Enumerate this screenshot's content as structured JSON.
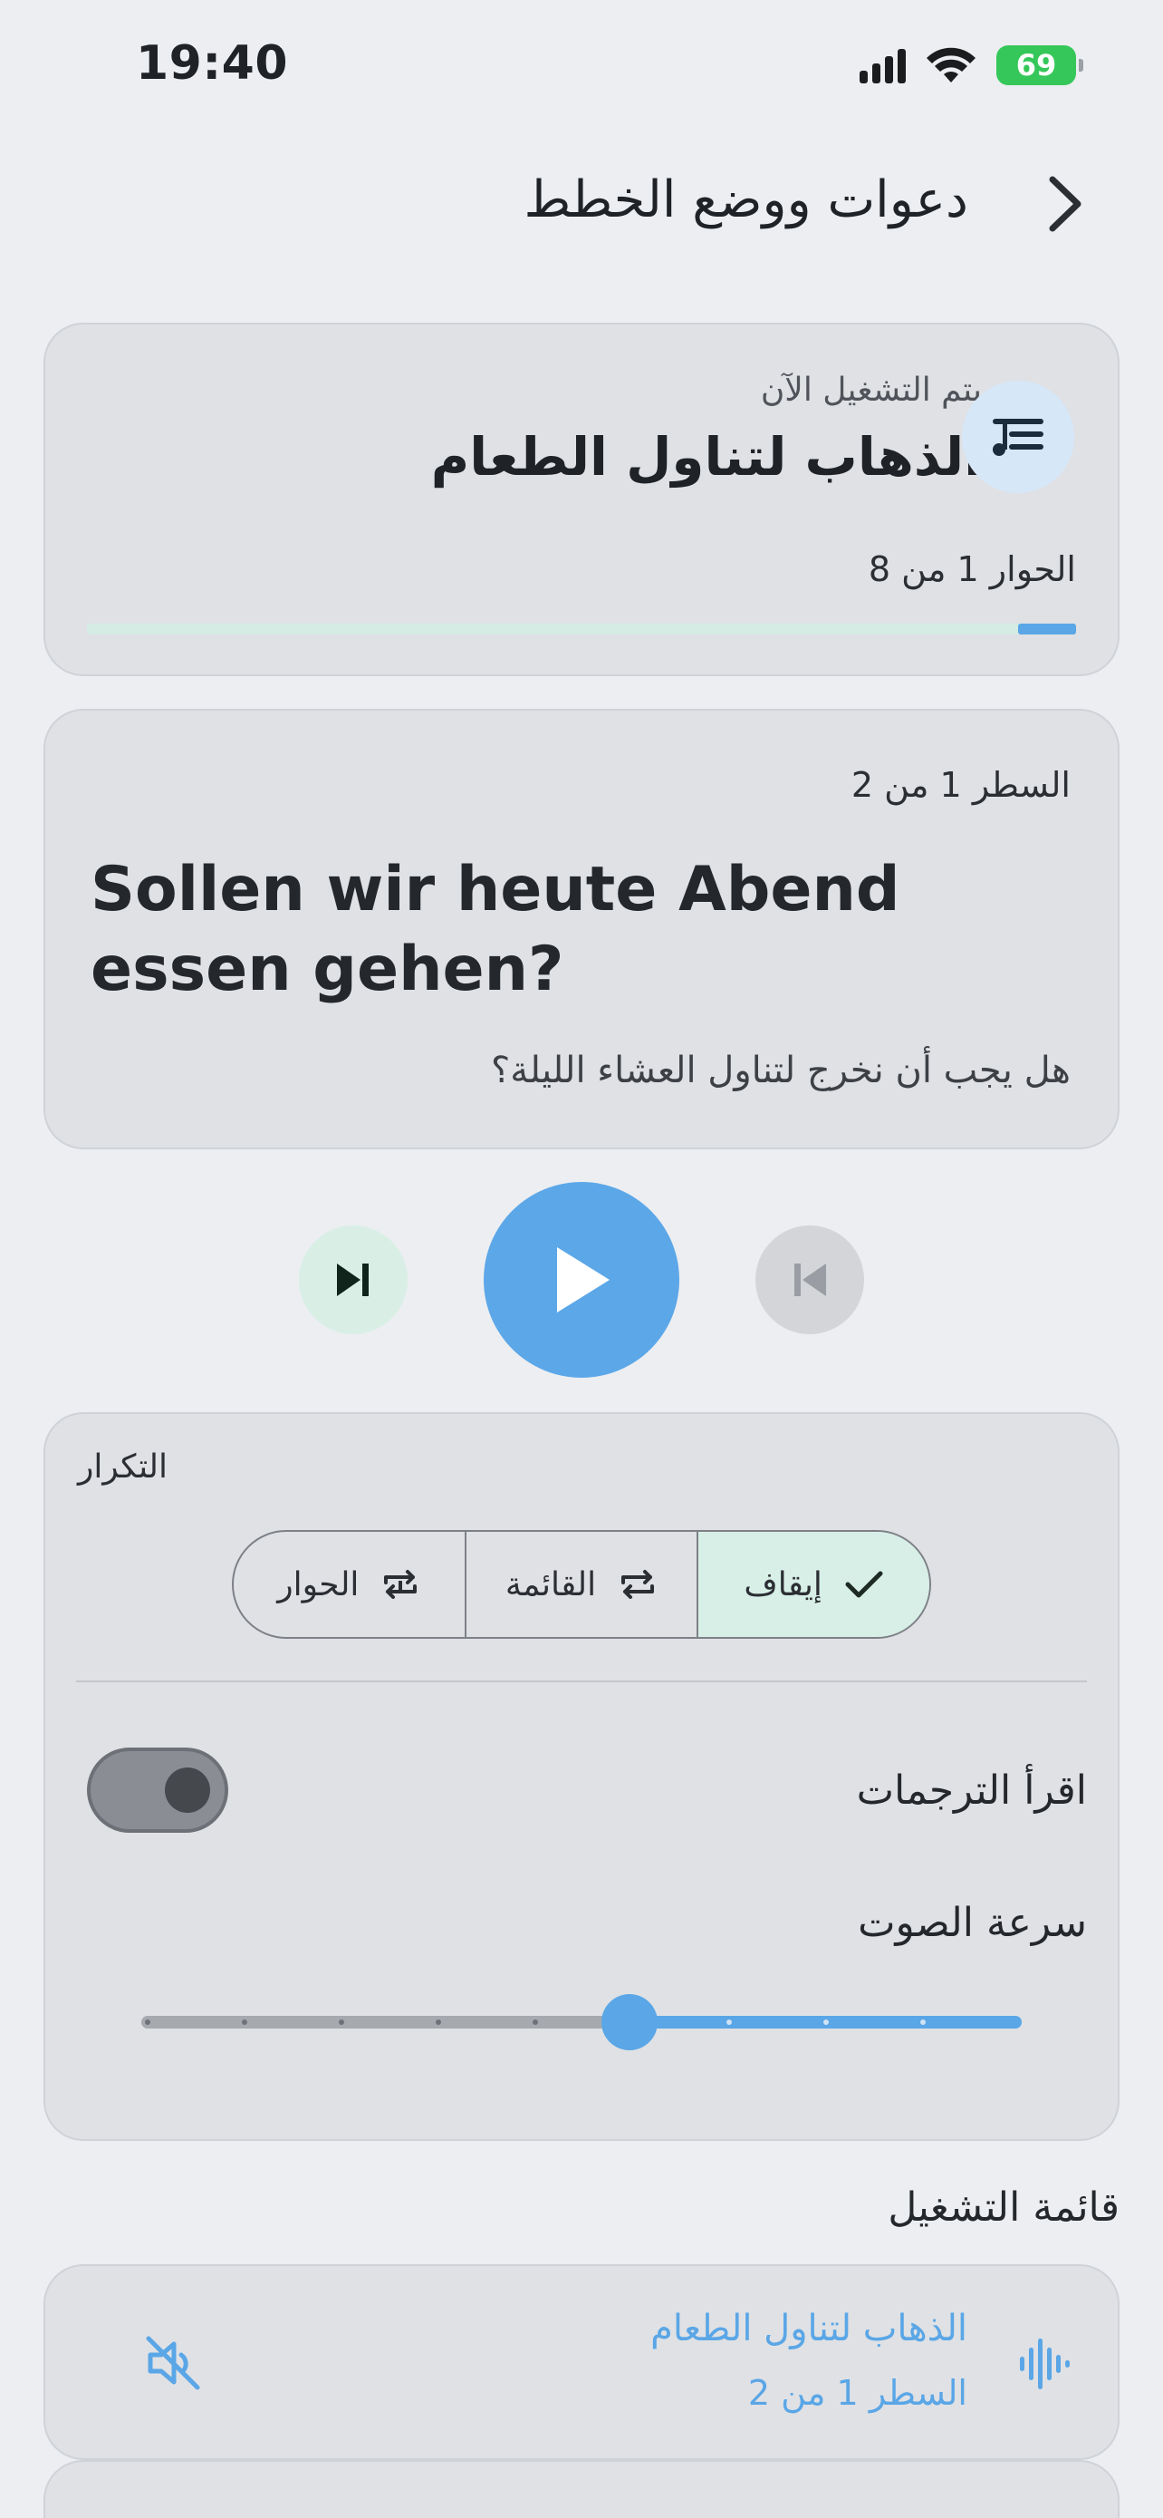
{
  "status_bar": {
    "time": "19:40",
    "battery": "69"
  },
  "header": {
    "title": "دعوات ووضع الخطط"
  },
  "now_playing": {
    "label": "يتم التشغيل الآن",
    "title": "الذهاب لتناول الطعام",
    "progress_text": "الحوار 1 من 8",
    "progress": 0.06
  },
  "current_line": {
    "label": "السطر 1 من 2",
    "text": "Sollen wir heute Abend essen gehen?",
    "translation": "هل يجب أن نخرج لتناول العشاء الليلة؟"
  },
  "repeat": {
    "label": "التكرار",
    "options": [
      "إيقاف",
      "القائمة",
      "الحوار"
    ],
    "selected": "إيقاف"
  },
  "read_subtitles": {
    "label": "اقرأ الترجمات",
    "enabled": false
  },
  "speed": {
    "label": "سرعة الصوت",
    "value_fraction": 0.556,
    "steps": 10
  },
  "playlist": {
    "header": "قائمة التشغيل",
    "items": [
      {
        "title": "الذهاب لتناول الطعام",
        "subtitle": "السطر 1 من 2",
        "active": true
      },
      {
        "title": "",
        "subtitle": "",
        "active": false
      }
    ]
  },
  "colors": {
    "accent": "#5aa6e6",
    "active_segment": "#d7efe6",
    "card": "#dfe1e5",
    "battery": "#35c759"
  }
}
